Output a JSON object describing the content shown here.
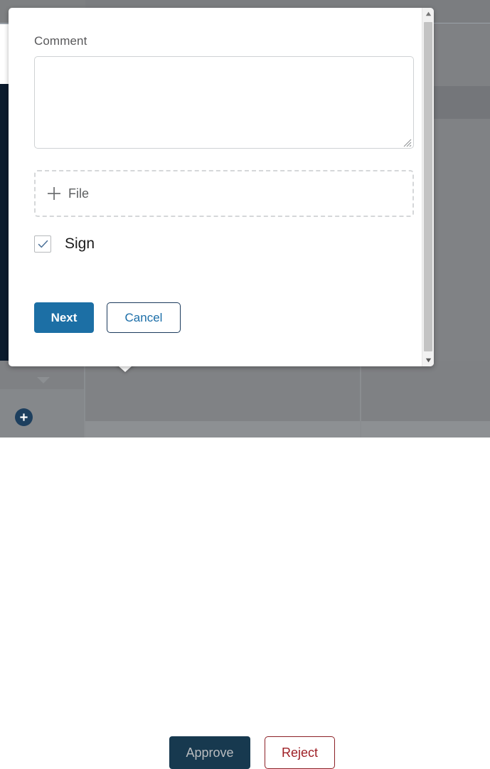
{
  "background": {
    "action_bar": {
      "approve_label": "Approve",
      "reject_label": "Reject"
    },
    "sidebar": {
      "caret_icon": "chevron-down-icon",
      "add_icon": "plus-circle-icon"
    },
    "colors": {
      "overlay_grey": "#808285",
      "sidebar_navy": "#0b1b2d",
      "approve_navy": "#17394f",
      "reject_red": "#9e1f25"
    }
  },
  "modal": {
    "comment": {
      "label": "Comment",
      "value": "",
      "placeholder": ""
    },
    "file_dropzone": {
      "label": "File",
      "icon": "plus-icon"
    },
    "sign": {
      "label": "Sign",
      "checked": true,
      "icon": "check-icon"
    },
    "actions": {
      "next_label": "Next",
      "cancel_label": "Cancel"
    },
    "scrollbar": {
      "up_icon": "triangle-up-icon",
      "down_icon": "triangle-down-icon"
    },
    "colors": {
      "primary_blue": "#1c6fa5",
      "border_navy": "#1b3a5c",
      "label_grey": "#58585a"
    }
  }
}
